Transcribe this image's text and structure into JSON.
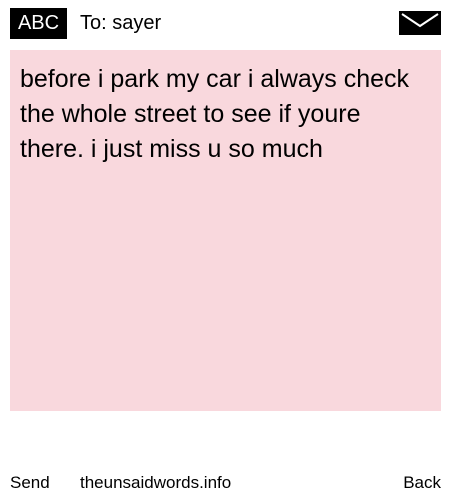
{
  "header": {
    "mode_label": "ABC",
    "recipient_label": "To: sayer",
    "icon": "envelope-icon"
  },
  "message": {
    "text": "before i park my car i always check the whole street to see if youre there. i just miss u so much",
    "background_color": "#f9d8dd"
  },
  "footer": {
    "send_label": "Send",
    "site_label": "theunsaidwords.info",
    "back_label": "Back"
  }
}
